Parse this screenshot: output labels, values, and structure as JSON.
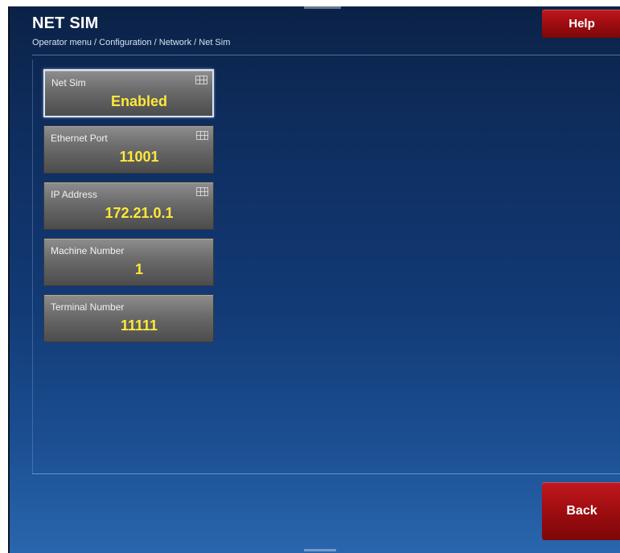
{
  "header": {
    "title": "NET SIM",
    "breadcrumb": "Operator menu / Configuration / Network / Net Sim",
    "help_label": "Help"
  },
  "settings": [
    {
      "label": "Net Sim",
      "value": "Enabled",
      "icon": "keypad-icon",
      "selected": true
    },
    {
      "label": "Ethernet Port",
      "value": "11001",
      "icon": "keypad-icon",
      "selected": false
    },
    {
      "label": "IP Address",
      "value": "172.21.0.1",
      "icon": "keypad-icon",
      "selected": false
    },
    {
      "label": "Machine Number",
      "value": "1",
      "selected": false
    },
    {
      "label": "Terminal Number",
      "value": "11111",
      "selected": false
    }
  ],
  "footer": {
    "back_label": "Back"
  },
  "colors": {
    "accent_red": "#b01218",
    "value_yellow": "#ffe83a",
    "background_blue": "#123a75"
  }
}
